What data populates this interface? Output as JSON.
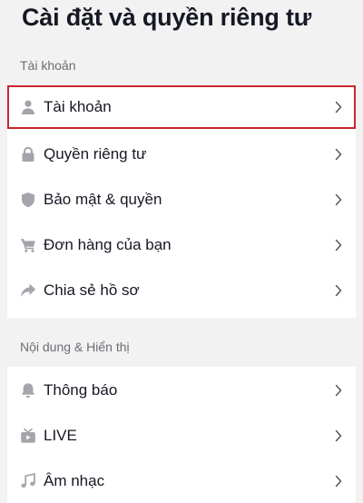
{
  "page": {
    "title": "Cài đặt và quyền riêng tư"
  },
  "sections": [
    {
      "header": "Tài khoản",
      "items": [
        {
          "label": "Tài khoản",
          "icon": "person-icon"
        },
        {
          "label": "Quyền riêng tư",
          "icon": "lock-icon"
        },
        {
          "label": "Bảo mật & quyền",
          "icon": "shield-icon"
        },
        {
          "label": "Đơn hàng của bạn",
          "icon": "cart-icon"
        },
        {
          "label": "Chia sẻ hồ sơ",
          "icon": "share-icon"
        }
      ]
    },
    {
      "header": "Nội dung & Hiển thị",
      "items": [
        {
          "label": "Thông báo",
          "icon": "bell-icon"
        },
        {
          "label": "LIVE",
          "icon": "tv-icon"
        },
        {
          "label": "Âm nhạc",
          "icon": "music-note-icon"
        }
      ]
    }
  ],
  "colors": {
    "background": "#f2f2f3",
    "card": "#ffffff",
    "text": "#161823",
    "secondary_text": "#6c6d72",
    "icon": "#a4a5aa",
    "highlight_border": "#c9262c"
  }
}
